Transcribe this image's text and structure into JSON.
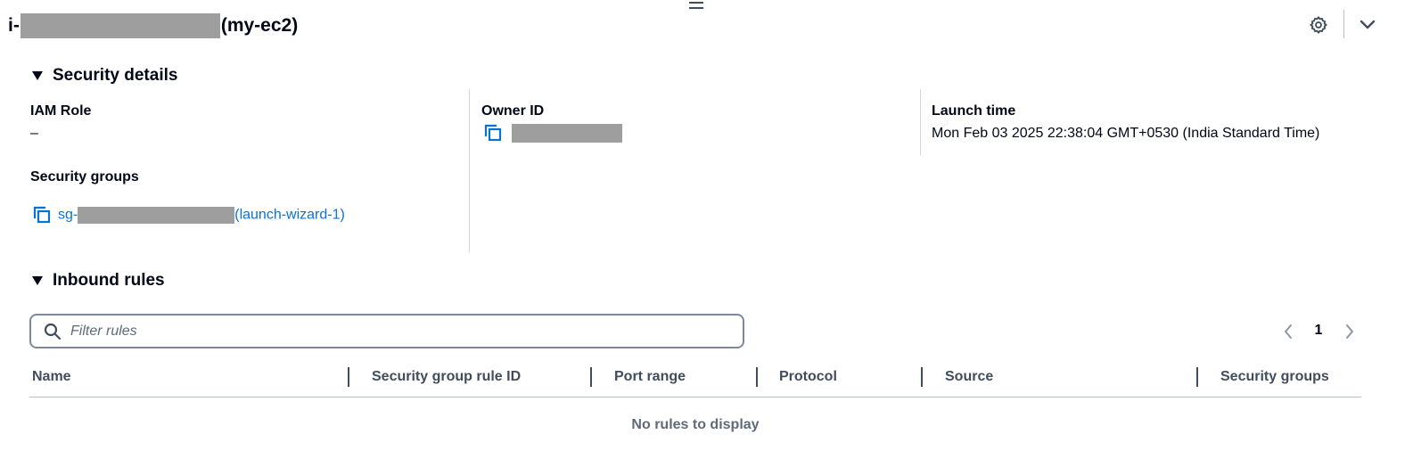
{
  "header": {
    "prefix": "i-",
    "suffix": "(my-ec2)",
    "settings_icon": "gear-icon",
    "collapse_icon": "chevron-down-icon"
  },
  "security_details": {
    "title": "Security details",
    "iam_role": {
      "label": "IAM Role",
      "value": "–"
    },
    "owner_id": {
      "label": "Owner ID"
    },
    "launch_time": {
      "label": "Launch time",
      "value": "Mon Feb 03 2025 22:38:04 GMT+0530 (India Standard Time)"
    },
    "security_groups": {
      "label": "Security groups",
      "prefix": "sg-",
      "suffix": "(launch-wizard-1)"
    }
  },
  "inbound_rules": {
    "title": "Inbound rules",
    "filter_placeholder": "Filter rules",
    "pagination": {
      "current_page": "1"
    },
    "columns": [
      "Name",
      "Security group rule ID",
      "Port range",
      "Protocol",
      "Source",
      "Security groups"
    ],
    "empty_message": "No rules to display"
  },
  "colors": {
    "link": "#0972d3",
    "text": "#000716",
    "redaction": "#9e9e9e"
  }
}
